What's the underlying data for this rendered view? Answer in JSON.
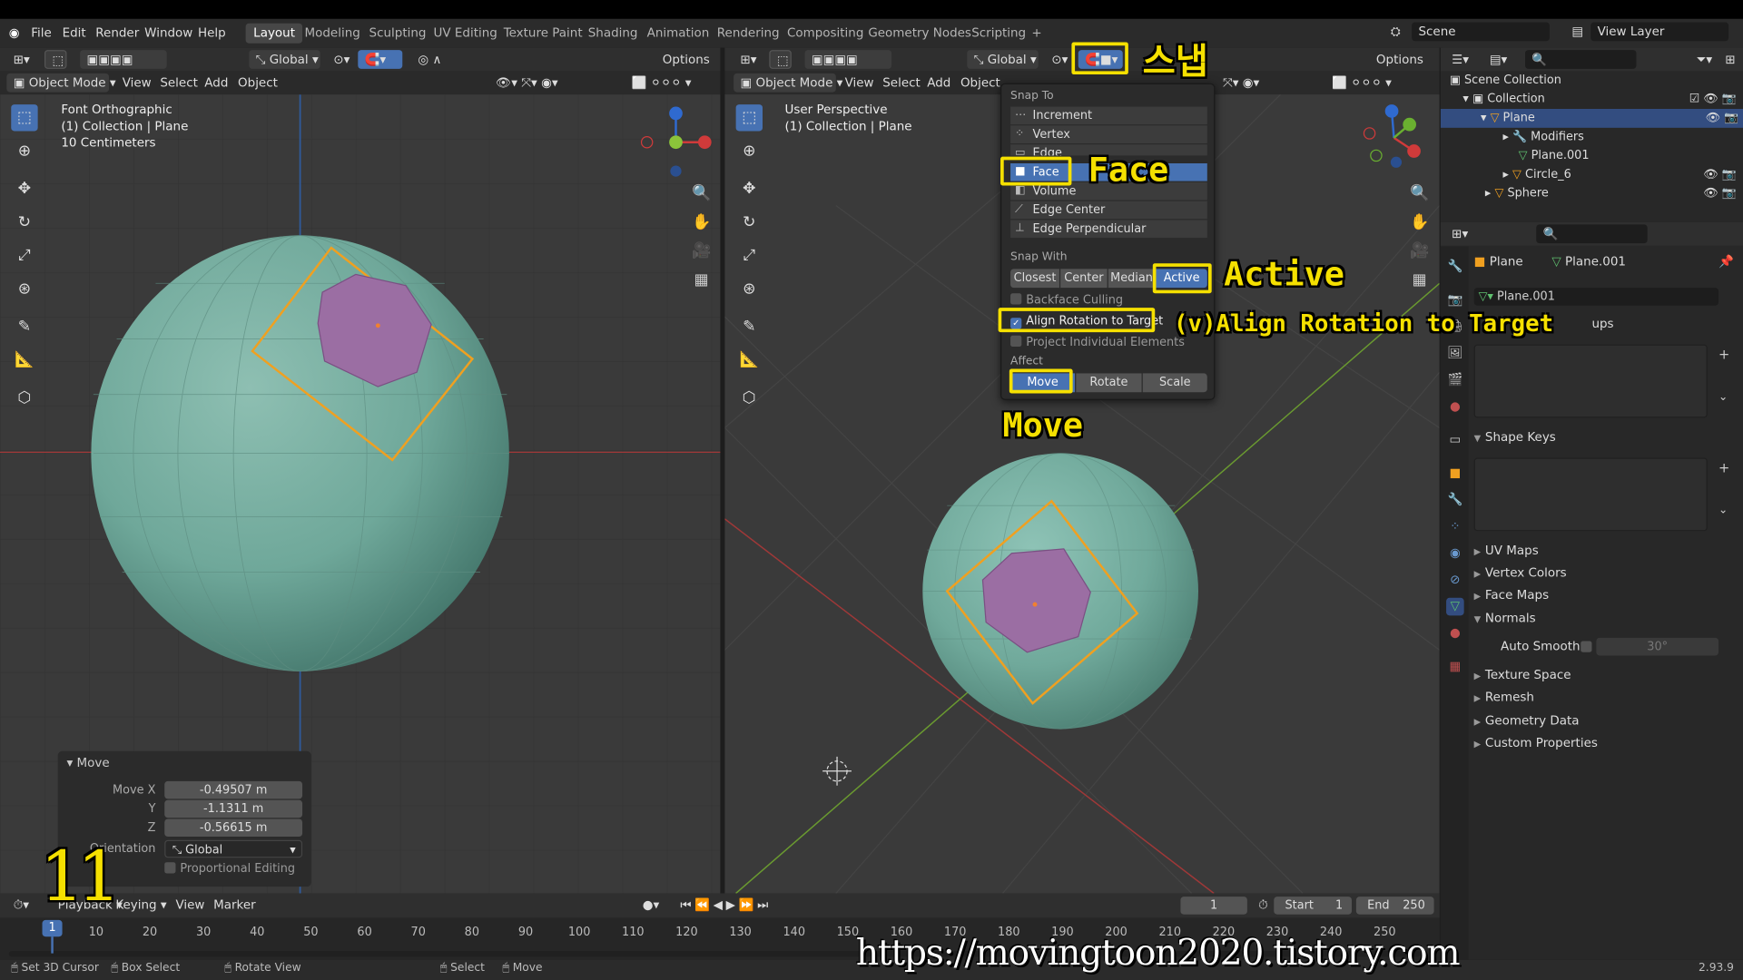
{
  "menu": {
    "file": "File",
    "edit": "Edit",
    "render": "Render",
    "window": "Window",
    "help": "Help"
  },
  "workspaces": [
    "Layout",
    "Modeling",
    "Sculpting",
    "UV Editing",
    "Texture Paint",
    "Shading",
    "Animation",
    "Rendering",
    "Compositing",
    "Geometry Nodes",
    "Scripting",
    "+"
  ],
  "scene": {
    "name": "Scene",
    "view_layer": "View Layer"
  },
  "left_view": {
    "orientation": "Global",
    "options": "Options",
    "mode": "Object Mode",
    "view": "View",
    "select": "Select",
    "add": "Add",
    "object": "Object",
    "info1": "Font Orthographic",
    "info2": "(1) Collection | Plane",
    "info3": "10 Centimeters"
  },
  "right_view": {
    "orientation": "Global",
    "options": "Options",
    "mode": "Object Mode",
    "view": "View",
    "select": "Select",
    "add": "Add",
    "object": "Object",
    "info1": "User Perspective",
    "info2": "(1) Collection | Plane"
  },
  "snap_popup": {
    "snap_to": "Snap To",
    "targets": [
      "Increment",
      "Vertex",
      "Edge",
      "Face",
      "Volume",
      "Edge Center",
      "Edge Perpendicular"
    ],
    "selected_target": "Face",
    "snap_with": "Snap With",
    "with_options": [
      "Closest",
      "Center",
      "Median",
      "Active"
    ],
    "selected_with": "Active",
    "backface": "Backface Culling",
    "align": "Align Rotation to Target",
    "align_checked": true,
    "project": "Project Individual Elements",
    "affect": "Affect",
    "affect_options": [
      "Move",
      "Rotate",
      "Scale"
    ],
    "selected_affect": "Move"
  },
  "annotations": {
    "snap": "스냅",
    "face": "Face",
    "active": "Active",
    "align": "(v)Align Rotation to Target",
    "move": "Move",
    "step": "11",
    "url": "https://movingtoon2020.tistory.com",
    "color": "#f5e000"
  },
  "operator_panel": {
    "title": "Move",
    "move_x_label": "Move X",
    "move_x": "-0.49507 m",
    "y_label": "Y",
    "y": "-1.1311 m",
    "z_label": "Z",
    "z": "-0.56615 m",
    "orientation_label": "Orientation",
    "orientation": "Global",
    "proportional": "Proportional Editing"
  },
  "outliner": {
    "scene_collection": "Scene Collection",
    "collection": "Collection",
    "plane": "Plane",
    "modifiers": "Modifiers",
    "plane_mesh": "Plane.001",
    "circle": "Circle_6",
    "sphere": "Sphere"
  },
  "properties": {
    "object": "Plane",
    "mesh": "Plane.001",
    "mesh_field": "Plane.001",
    "groups": "ups",
    "shape_keys": "Shape Keys",
    "uv_maps": "UV Maps",
    "vertex_colors": "Vertex Colors",
    "face_maps": "Face Maps",
    "normals": "Normals",
    "auto_smooth": "Auto Smooth",
    "angle": "30°",
    "texture_space": "Texture Space",
    "remesh": "Remesh",
    "geometry_data": "Geometry Data",
    "custom_properties": "Custom Properties"
  },
  "timeline": {
    "playback": "Playback",
    "keying": "Keying",
    "view": "View",
    "marker": "Marker",
    "current": "1",
    "start_label": "Start",
    "start": "1",
    "end_label": "End",
    "end": "250",
    "ticks": [
      "1",
      "10",
      "20",
      "30",
      "40",
      "50",
      "60",
      "70",
      "80",
      "90",
      "100",
      "110",
      "120",
      "130",
      "140",
      "150",
      "160",
      "170",
      "180",
      "190",
      "200",
      "210",
      "220",
      "230",
      "240",
      "250"
    ],
    "current_frame": 1
  },
  "status": {
    "cursor": "Set 3D Cursor",
    "box": "Box Select",
    "rotate": "Rotate View",
    "select": "Select",
    "move": "Move",
    "version": "2.93.9"
  },
  "colors": {
    "accent": "#4772b3",
    "viewport": "#3a3a3a",
    "sphere": "#6fa89a",
    "face_purple": "#9b6ea3",
    "outline_orange": "#f0a020"
  }
}
